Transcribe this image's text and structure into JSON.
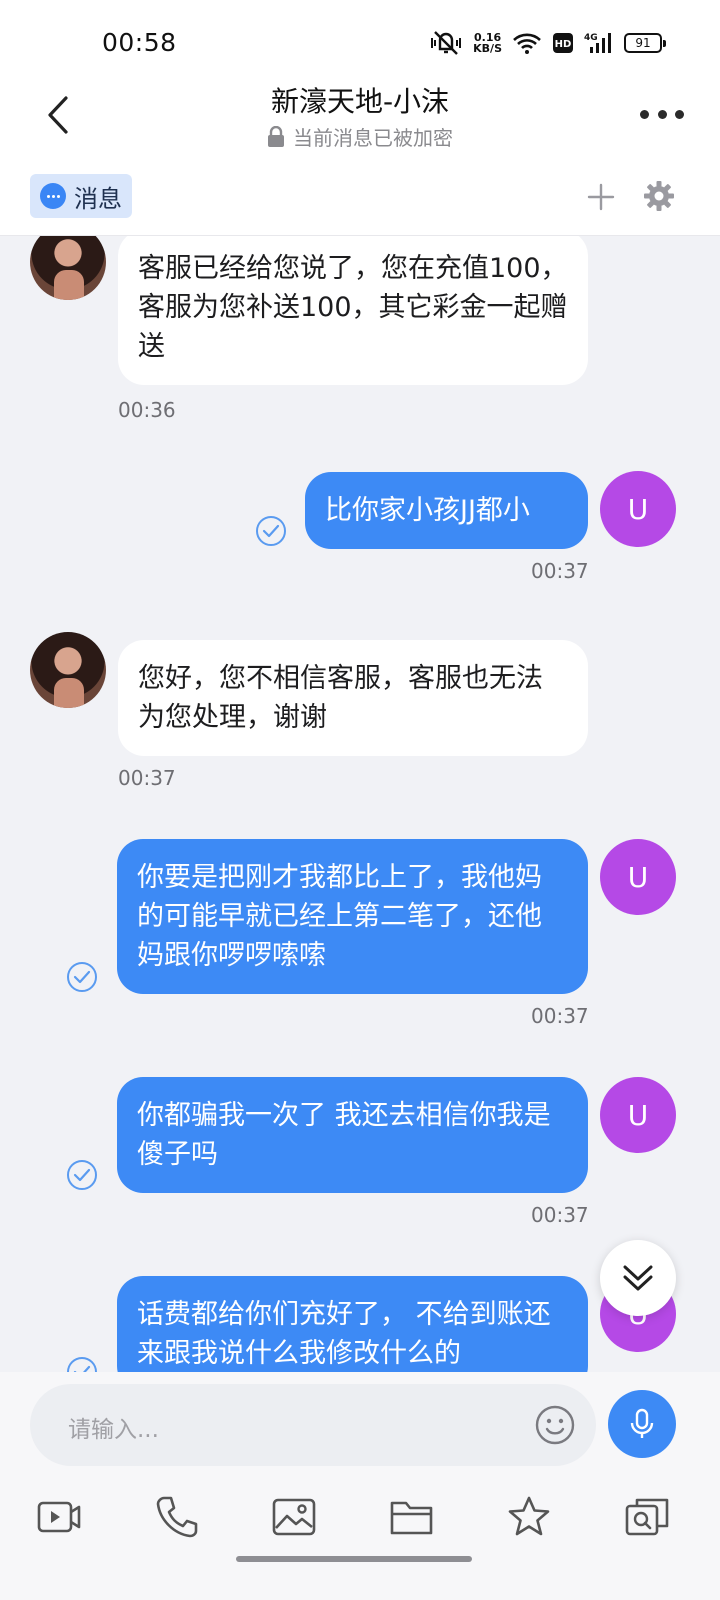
{
  "status_bar": {
    "time": "00:58",
    "net_speed_value": "0.16",
    "net_speed_unit": "KB/S",
    "hd_label": "HD",
    "signal_label": "4G",
    "battery": "91"
  },
  "header": {
    "title": "新濠天地-小沫",
    "subtitle": "当前消息已被加密"
  },
  "tabs": {
    "messages_label": "消息"
  },
  "messages": [
    {
      "side": "in",
      "text": "客服已经给您说了，您在充值100，客服为您补送100，其它彩金一起赠送",
      "time": "00:36"
    },
    {
      "side": "out",
      "text": "比你家小孩JJ都小",
      "time": "00:37",
      "avatar": "U"
    },
    {
      "side": "in",
      "text": "您好，您不相信客服，客服也无法为您处理，谢谢",
      "time": "00:37"
    },
    {
      "side": "out",
      "text": "你要是把刚才我都比上了，我他妈的可能早就已经上第二笔了，还他妈跟你啰啰嗦嗦",
      "time": "00:37",
      "avatar": "U"
    },
    {
      "side": "out",
      "text": "你都骗我一次了 我还去相信你我是傻子吗",
      "time": "00:37",
      "avatar": "U"
    },
    {
      "side": "out",
      "text": "话费都给你们充好了， 不给到账还来跟我说什么我修改什么的",
      "time": "",
      "avatar": "U"
    }
  ],
  "input": {
    "placeholder": "请输入..."
  },
  "toolbar_icons": [
    "video-icon",
    "phone-icon",
    "image-icon",
    "folder-icon",
    "star-icon",
    "screen-search-icon"
  ],
  "colors": {
    "accent": "#3d8af5",
    "user_avatar": "#b549e6",
    "background": "#f1f2f6"
  }
}
